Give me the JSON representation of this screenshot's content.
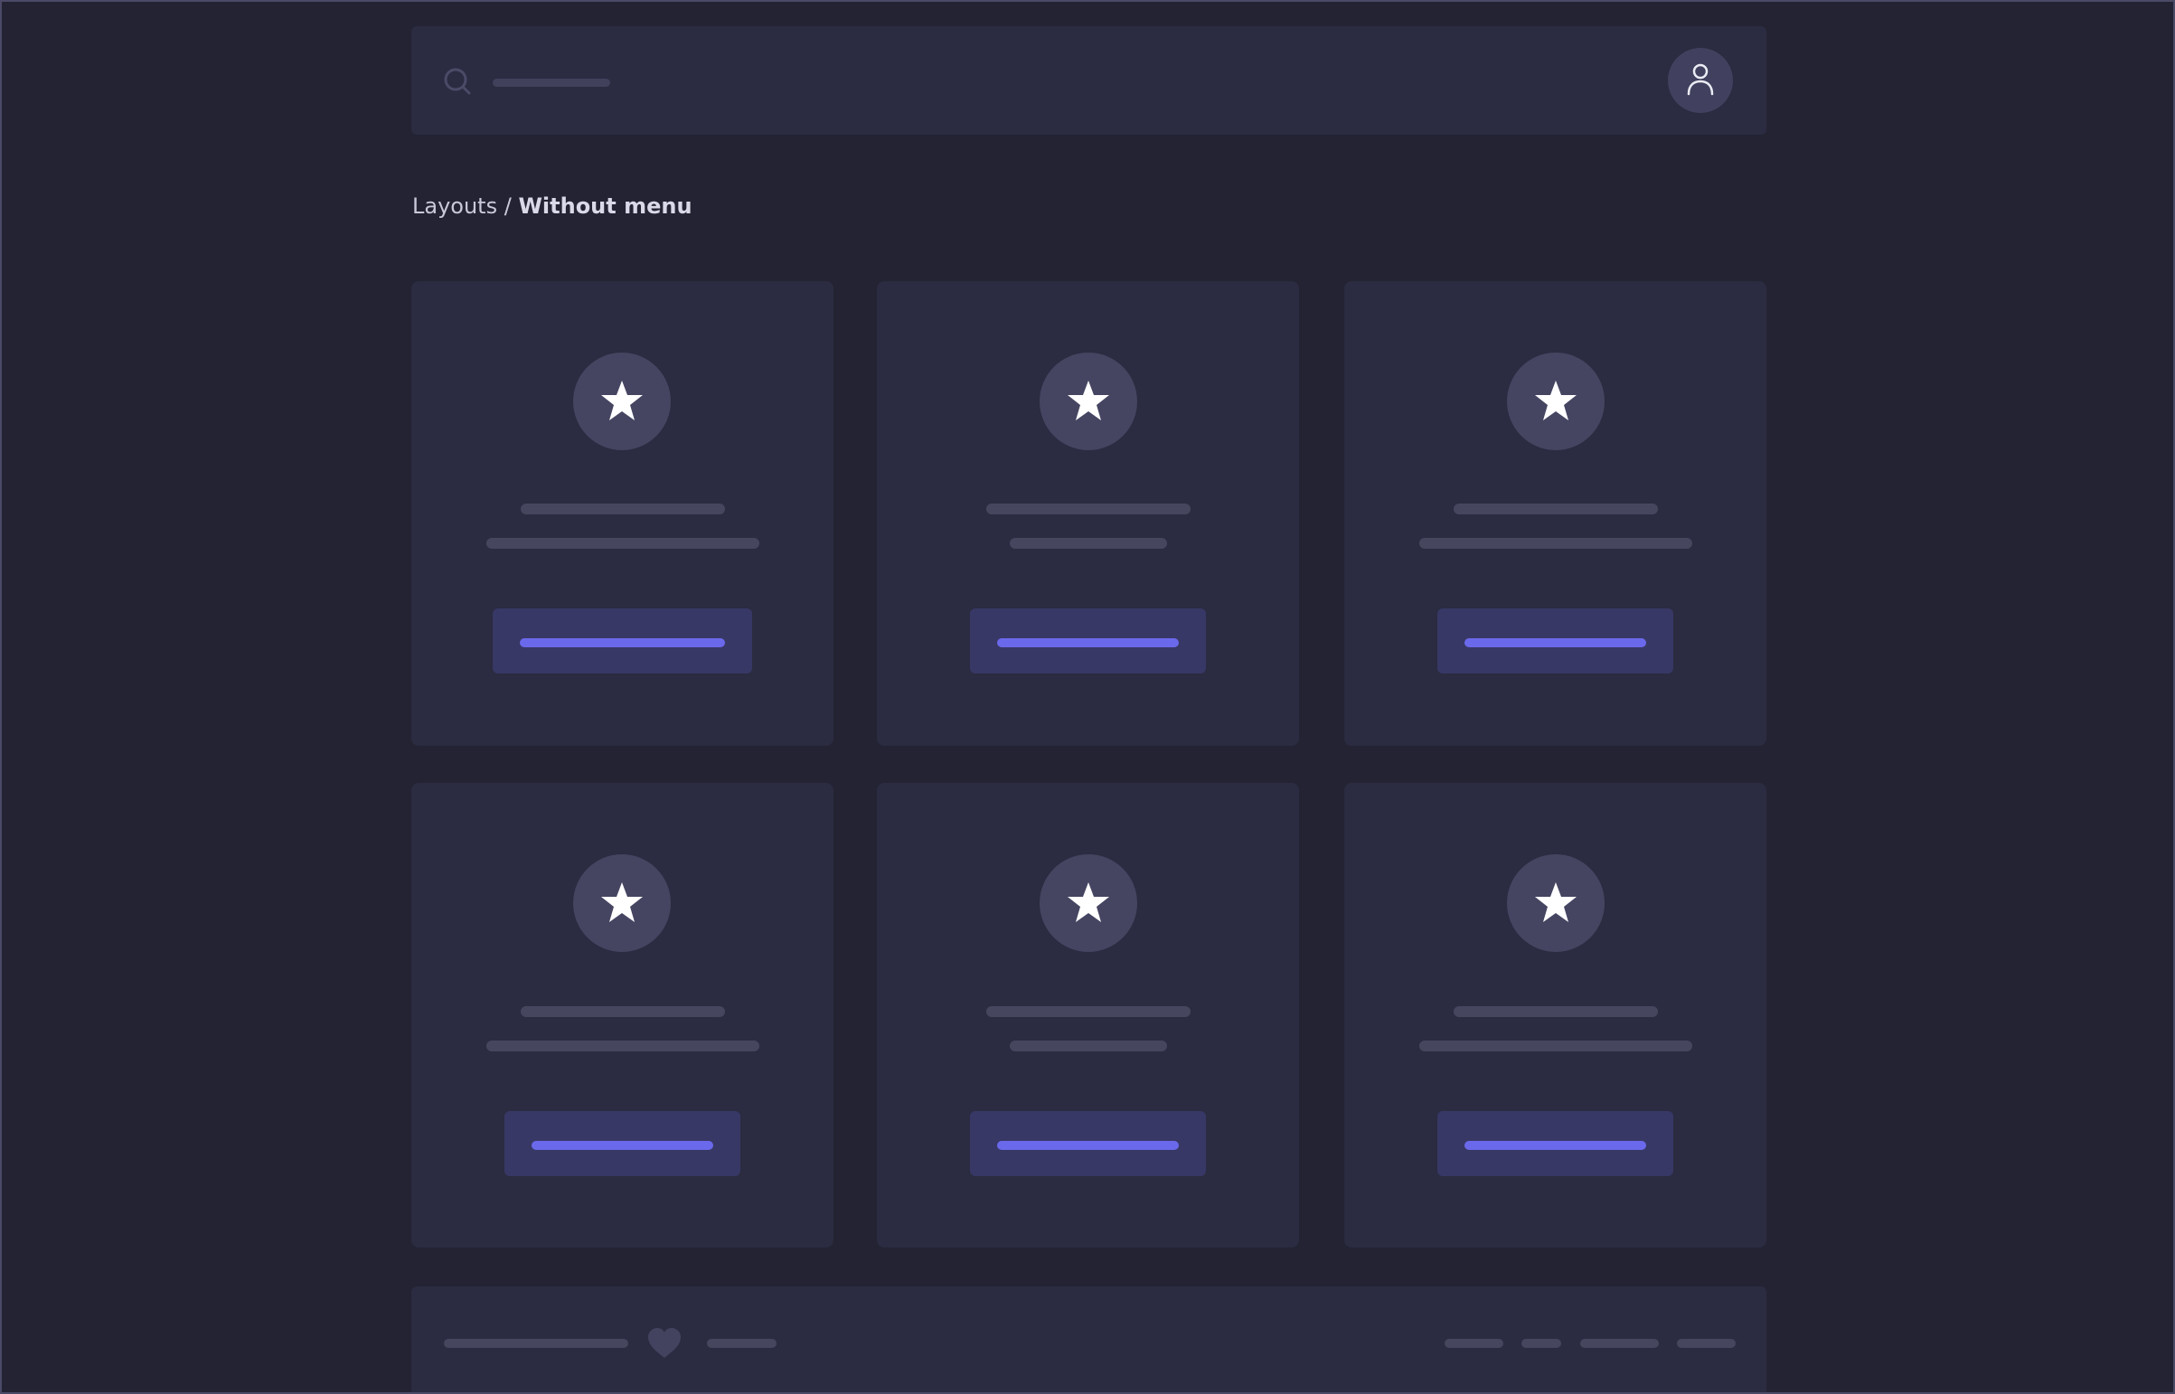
{
  "breadcrumb": {
    "parent": "Layouts",
    "separator": " / ",
    "current": "Without menu"
  },
  "navbar": {
    "search_icon": "search-icon",
    "avatar_icon": "user-icon"
  },
  "cards": [
    {
      "icon": "star-icon"
    },
    {
      "icon": "star-icon"
    },
    {
      "icon": "star-icon"
    },
    {
      "icon": "star-icon"
    },
    {
      "icon": "star-icon"
    },
    {
      "icon": "star-icon"
    }
  ],
  "footer": {
    "icon": "heart-icon"
  },
  "colors": {
    "background": "#232333",
    "surface": "#2b2b41",
    "placeholder": "#46465f",
    "accent": "#6b69eb",
    "button": "#383866"
  }
}
